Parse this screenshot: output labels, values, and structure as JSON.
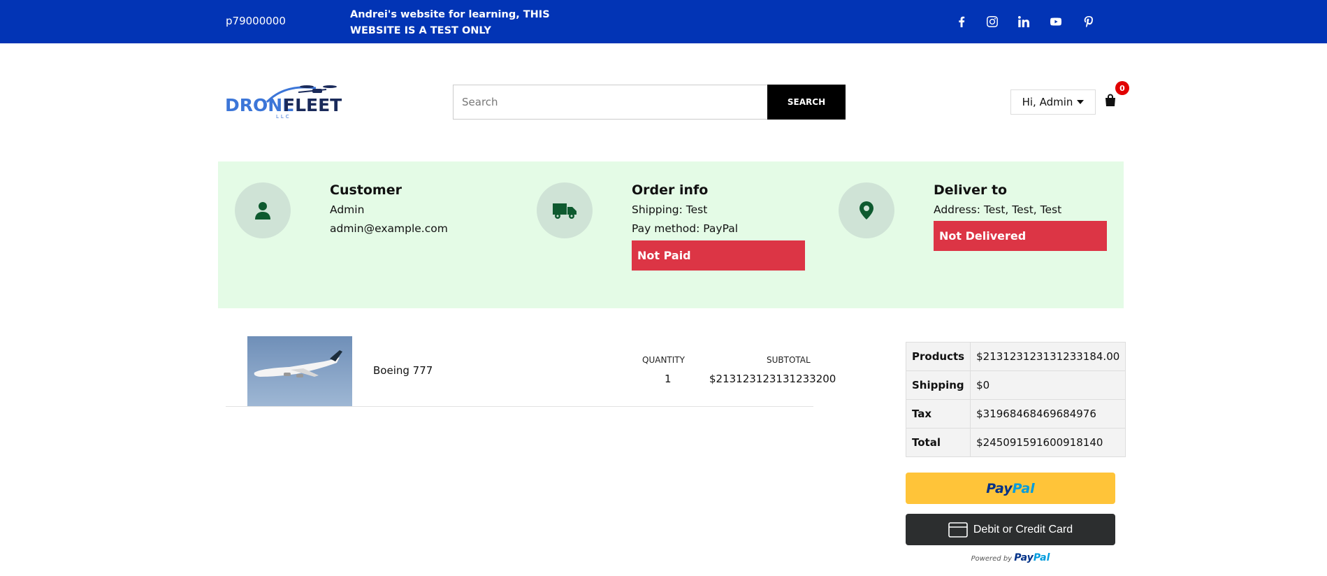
{
  "topbar": {
    "phone": "p79000000",
    "notice": "Andrei's website for learning, THIS WEBSITE IS A TEST ONLY",
    "social_icons": [
      "facebook-icon",
      "instagram-icon",
      "linkedin-icon",
      "youtube-icon",
      "pinterest-icon"
    ]
  },
  "logo": {
    "word1": "DRONE",
    "word2": "FLEET",
    "sub": "LLC"
  },
  "search": {
    "placeholder": "Search",
    "button_label": "SEARCH"
  },
  "user": {
    "greeting": "Hi, Admin",
    "cart_count": "0"
  },
  "customer": {
    "title": "Customer",
    "name": "Admin",
    "email": "admin@example.com"
  },
  "order_info": {
    "title": "Order info",
    "shipping": "Shipping: Test",
    "pay_method": "Pay method: PayPal",
    "status": "Not Paid"
  },
  "deliver": {
    "title": "Deliver to",
    "address": "Address: Test, Test, Test",
    "status": "Not Delivered"
  },
  "item": {
    "name": "Boeing 777",
    "quantity_label": "QUANTITY",
    "quantity": "1",
    "subtotal_label": "SUBTOTAL",
    "subtotal": "$213123123131233200"
  },
  "totals": [
    {
      "label": "Products",
      "value": "$213123123131233184.00"
    },
    {
      "label": "Shipping",
      "value": "$0"
    },
    {
      "label": "Tax",
      "value": "$31968468469684976"
    },
    {
      "label": "Total",
      "value": "$245091591600918140"
    }
  ],
  "payment": {
    "paypal_1": "Pay",
    "paypal_2": "Pal",
    "card_label": "Debit or Credit Card",
    "powered_by": "Powered by"
  },
  "colors": {
    "topbar": "#0234b5",
    "panel": "#e4fbe6",
    "alert": "#dc3545",
    "paypal": "#ffc439"
  }
}
